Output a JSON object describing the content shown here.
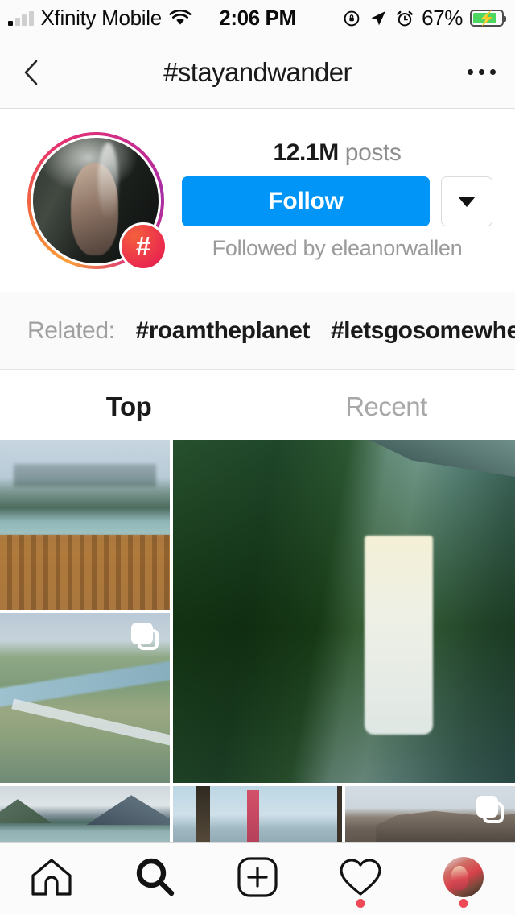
{
  "status_bar": {
    "carrier": "Xfinity Mobile",
    "signal_bars_filled": 1,
    "signal_bars_total": 4,
    "wifi_icon": "wifi-icon",
    "time": "2:06 PM",
    "rotation_lock_icon": "rotation-lock-icon",
    "location_icon": "location-arrow-icon",
    "alarm_icon": "alarm-clock-icon",
    "battery_percent": "67%",
    "battery_charging": true,
    "battery_color": "#4cd763"
  },
  "header": {
    "back_icon": "back-chevron-icon",
    "title": "#stayandwander",
    "more_icon": "more-options-icon"
  },
  "profile": {
    "avatar_badge_glyph": "#",
    "posts_count": "12.1M",
    "posts_label": "posts",
    "follow_label": "Follow",
    "follow_color": "#0095f6",
    "dropdown_icon": "chevron-down-icon",
    "followed_by": "Followed by eleanorwallen"
  },
  "related": {
    "label": "Related:",
    "tags": [
      "#roamtheplanet",
      "#letsgosomewhere"
    ]
  },
  "tabs": {
    "items": [
      {
        "label": "Top",
        "active": true
      },
      {
        "label": "Recent",
        "active": false
      }
    ]
  },
  "grid": {
    "row1": [
      {
        "name": "post-lake-dock",
        "alt": "Person on wooden dock by mountain lake",
        "multi": false
      },
      {
        "name": "post-aerial-river",
        "alt": "Aerial view of winding river and bridge",
        "multi": true
      },
      {
        "name": "post-waterfall",
        "alt": "Aerial waterfall in rainforest with plane wing",
        "multi": false
      }
    ],
    "row2": [
      {
        "name": "post-mountain-lake",
        "alt": "Mountain lake with reflections",
        "multi": false
      },
      {
        "name": "post-golden-gate",
        "alt": "Golden Gate Bridge framed by trees",
        "multi": false
      },
      {
        "name": "post-cliffs",
        "alt": "Rocky cliff formation",
        "multi": true
      }
    ],
    "multi_icon": "carousel-icon"
  },
  "tabbar": {
    "items": [
      {
        "name": "home",
        "icon": "home-icon",
        "active": false,
        "badge": false
      },
      {
        "name": "search",
        "icon": "search-icon",
        "active": true,
        "badge": false
      },
      {
        "name": "new-post",
        "icon": "add-post-icon",
        "active": false,
        "badge": false
      },
      {
        "name": "activity",
        "icon": "heart-icon",
        "active": false,
        "badge": true
      },
      {
        "name": "profile",
        "icon": "profile-avatar-icon",
        "active": false,
        "badge": true
      }
    ],
    "badge_color": "#ed4956"
  }
}
